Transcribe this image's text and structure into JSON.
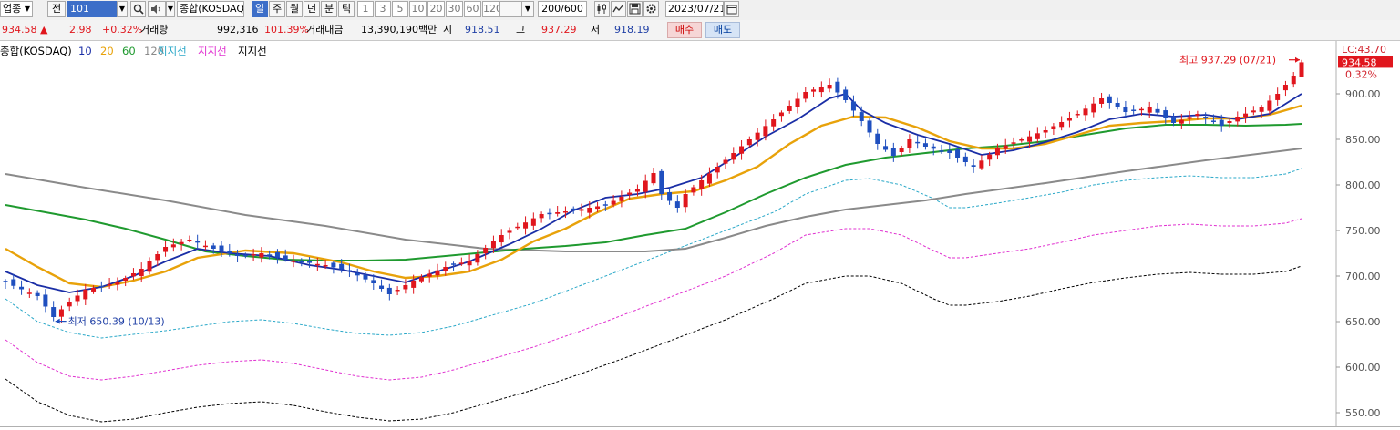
{
  "toolbar": {
    "market_type": "업종",
    "prev_label": "전",
    "code": "101",
    "sound_icon": "speaker-icon",
    "index_name": "종합(KOSDAQ)",
    "periods": [
      "일",
      "주",
      "월",
      "년",
      "분",
      "틱"
    ],
    "selected_period": "일",
    "intervals": [
      "1",
      "3",
      "5",
      "10",
      "20",
      "30",
      "60",
      "120"
    ],
    "count_display": "200/600",
    "date": "2023/07/21"
  },
  "info": {
    "price": "934.58",
    "direction_symbol": "▲",
    "change": "2.98",
    "change_pct": "+0.32%",
    "volume_label": "거래량",
    "volume": "992,316",
    "volume_ratio": "101.39%",
    "amount_label": "거래대금",
    "amount": "13,390,190백만",
    "open_label": "시",
    "open": "918.51",
    "high_label": "고",
    "high": "937.29",
    "low_label": "저",
    "low": "918.19",
    "buy_label": "매수",
    "sell_label": "매도"
  },
  "legend": {
    "index_name": "종합(KOSDAQ)",
    "ma": [
      {
        "label": "10",
        "color": "#1a2ea6"
      },
      {
        "label": "20",
        "color": "#e8a20a"
      },
      {
        "label": "60",
        "color": "#1f9a2f"
      },
      {
        "label": "120",
        "color": "#8a8a8a"
      }
    ],
    "support": [
      {
        "label": "지지선",
        "color": "#2aa8c8"
      },
      {
        "label": "지지선",
        "color": "#e030d0"
      },
      {
        "label": "지지선",
        "color": "#000000"
      }
    ]
  },
  "annotations": {
    "high_text": "최고 937.29 (07/21)",
    "low_text": "최저 650.39 (10/13)",
    "lc_text": "LC:43.70",
    "last_price_tag": "934.58",
    "last_pct_tag": "0.32%"
  },
  "chart_data": {
    "type": "candlestick",
    "y_ticks": [
      "900.00",
      "850.00",
      "800.00",
      "750.00",
      "700.00",
      "650.00",
      "600.00",
      "550.00"
    ],
    "y_tick_values": [
      900,
      850,
      800,
      750,
      700,
      650,
      600,
      550
    ],
    "ylim": [
      534,
      950
    ],
    "colors": {
      "up": "#e0161d",
      "down": "#1f4fbf",
      "ma10": "#1a2ea6",
      "ma20": "#e8a20a",
      "ma60": "#1f9a2f",
      "ma120": "#8a8a8a",
      "support1": "#2aa8c8",
      "support2": "#e030d0",
      "support3": "#000000"
    },
    "price_path": [
      [
        0,
        693
      ],
      [
        4,
        678
      ],
      [
        6,
        655
      ],
      [
        8,
        672
      ],
      [
        10,
        685
      ],
      [
        14,
        693
      ],
      [
        17,
        708
      ],
      [
        20,
        732
      ],
      [
        23,
        740
      ],
      [
        26,
        730
      ],
      [
        29,
        722
      ],
      [
        32,
        725
      ],
      [
        35,
        718
      ],
      [
        40,
        712
      ],
      [
        43,
        705
      ],
      [
        46,
        692
      ],
      [
        48,
        680
      ],
      [
        51,
        695
      ],
      [
        55,
        710
      ],
      [
        58,
        717
      ],
      [
        62,
        745
      ],
      [
        67,
        768
      ],
      [
        71,
        772
      ],
      [
        75,
        778
      ],
      [
        79,
        796
      ],
      [
        81,
        813
      ],
      [
        82,
        790
      ],
      [
        84,
        775
      ],
      [
        85,
        790
      ],
      [
        87,
        805
      ],
      [
        93,
        850
      ],
      [
        96,
        872
      ],
      [
        100,
        902
      ],
      [
        103,
        910
      ],
      [
        105,
        893
      ],
      [
        107,
        870
      ],
      [
        109,
        845
      ],
      [
        111,
        832
      ],
      [
        113,
        850
      ],
      [
        115,
        842
      ],
      [
        118,
        835
      ],
      [
        121,
        820
      ],
      [
        124,
        840
      ],
      [
        127,
        850
      ],
      [
        130,
        860
      ],
      [
        134,
        878
      ],
      [
        137,
        895
      ],
      [
        140,
        880
      ],
      [
        143,
        885
      ],
      [
        146,
        868
      ],
      [
        149,
        878
      ],
      [
        152,
        865
      ],
      [
        154,
        875
      ],
      [
        157,
        885
      ],
      [
        159,
        900
      ],
      [
        161,
        920
      ],
      [
        162,
        934.58
      ]
    ],
    "ma10": [
      [
        0,
        705
      ],
      [
        4,
        690
      ],
      [
        8,
        682
      ],
      [
        12,
        688
      ],
      [
        16,
        700
      ],
      [
        20,
        716
      ],
      [
        24,
        730
      ],
      [
        28,
        725
      ],
      [
        33,
        722
      ],
      [
        38,
        712
      ],
      [
        42,
        707
      ],
      [
        46,
        700
      ],
      [
        50,
        693
      ],
      [
        54,
        705
      ],
      [
        58,
        716
      ],
      [
        63,
        735
      ],
      [
        67,
        752
      ],
      [
        71,
        772
      ],
      [
        75,
        786
      ],
      [
        79,
        790
      ],
      [
        83,
        797
      ],
      [
        87,
        808
      ],
      [
        91,
        830
      ],
      [
        95,
        853
      ],
      [
        99,
        872
      ],
      [
        103,
        895
      ],
      [
        105,
        900
      ],
      [
        107,
        882
      ],
      [
        110,
        868
      ],
      [
        114,
        855
      ],
      [
        118,
        845
      ],
      [
        122,
        833
      ],
      [
        126,
        838
      ],
      [
        130,
        847
      ],
      [
        134,
        858
      ],
      [
        138,
        872
      ],
      [
        142,
        878
      ],
      [
        146,
        875
      ],
      [
        150,
        877
      ],
      [
        154,
        872
      ],
      [
        158,
        878
      ],
      [
        162,
        900
      ]
    ],
    "ma20": [
      [
        0,
        730
      ],
      [
        4,
        710
      ],
      [
        8,
        692
      ],
      [
        12,
        688
      ],
      [
        16,
        695
      ],
      [
        20,
        705
      ],
      [
        24,
        720
      ],
      [
        30,
        728
      ],
      [
        36,
        725
      ],
      [
        42,
        715
      ],
      [
        46,
        705
      ],
      [
        50,
        698
      ],
      [
        54,
        700
      ],
      [
        58,
        705
      ],
      [
        62,
        718
      ],
      [
        66,
        738
      ],
      [
        70,
        752
      ],
      [
        74,
        770
      ],
      [
        78,
        785
      ],
      [
        82,
        790
      ],
      [
        86,
        793
      ],
      [
        90,
        805
      ],
      [
        94,
        820
      ],
      [
        98,
        845
      ],
      [
        102,
        865
      ],
      [
        106,
        875
      ],
      [
        110,
        874
      ],
      [
        114,
        863
      ],
      [
        118,
        848
      ],
      [
        122,
        840
      ],
      [
        126,
        840
      ],
      [
        130,
        845
      ],
      [
        134,
        855
      ],
      [
        138,
        865
      ],
      [
        142,
        868
      ],
      [
        146,
        870
      ],
      [
        150,
        873
      ],
      [
        154,
        873
      ],
      [
        158,
        877
      ],
      [
        162,
        887
      ]
    ],
    "ma60": [
      [
        0,
        778
      ],
      [
        5,
        770
      ],
      [
        10,
        762
      ],
      [
        15,
        752
      ],
      [
        20,
        740
      ],
      [
        25,
        727
      ],
      [
        30,
        722
      ],
      [
        35,
        718
      ],
      [
        40,
        717
      ],
      [
        45,
        717
      ],
      [
        50,
        718
      ],
      [
        55,
        722
      ],
      [
        60,
        726
      ],
      [
        65,
        730
      ],
      [
        70,
        733
      ],
      [
        75,
        737
      ],
      [
        80,
        745
      ],
      [
        85,
        752
      ],
      [
        90,
        770
      ],
      [
        95,
        790
      ],
      [
        100,
        808
      ],
      [
        105,
        822
      ],
      [
        110,
        830
      ],
      [
        115,
        835
      ],
      [
        120,
        840
      ],
      [
        125,
        843
      ],
      [
        130,
        848
      ],
      [
        135,
        855
      ],
      [
        140,
        862
      ],
      [
        145,
        866
      ],
      [
        150,
        866
      ],
      [
        155,
        865
      ],
      [
        160,
        866
      ],
      [
        162,
        867
      ]
    ],
    "ma120": [
      [
        0,
        812
      ],
      [
        10,
        797
      ],
      [
        20,
        783
      ],
      [
        30,
        767
      ],
      [
        40,
        755
      ],
      [
        50,
        740
      ],
      [
        60,
        730
      ],
      [
        70,
        727
      ],
      [
        80,
        727
      ],
      [
        85,
        730
      ],
      [
        90,
        742
      ],
      [
        95,
        755
      ],
      [
        100,
        765
      ],
      [
        105,
        773
      ],
      [
        110,
        778
      ],
      [
        115,
        783
      ],
      [
        120,
        790
      ],
      [
        130,
        802
      ],
      [
        140,
        815
      ],
      [
        150,
        827
      ],
      [
        162,
        840
      ]
    ],
    "support1": [
      [
        0,
        675
      ],
      [
        4,
        650
      ],
      [
        8,
        638
      ],
      [
        12,
        632
      ],
      [
        16,
        636
      ],
      [
        20,
        640
      ],
      [
        24,
        645
      ],
      [
        28,
        650
      ],
      [
        32,
        652
      ],
      [
        36,
        648
      ],
      [
        40,
        642
      ],
      [
        44,
        637
      ],
      [
        48,
        635
      ],
      [
        52,
        638
      ],
      [
        56,
        645
      ],
      [
        60,
        655
      ],
      [
        66,
        670
      ],
      [
        72,
        690
      ],
      [
        78,
        710
      ],
      [
        84,
        730
      ],
      [
        90,
        750
      ],
      [
        96,
        770
      ],
      [
        100,
        790
      ],
      [
        105,
        805
      ],
      [
        108,
        807
      ],
      [
        112,
        800
      ],
      [
        116,
        785
      ],
      [
        118,
        775
      ],
      [
        120,
        775
      ],
      [
        124,
        780
      ],
      [
        128,
        786
      ],
      [
        132,
        792
      ],
      [
        136,
        800
      ],
      [
        140,
        805
      ],
      [
        144,
        808
      ],
      [
        148,
        810
      ],
      [
        152,
        808
      ],
      [
        156,
        808
      ],
      [
        160,
        812
      ],
      [
        162,
        818
      ]
    ],
    "support2": [
      [
        0,
        630
      ],
      [
        4,
        605
      ],
      [
        8,
        590
      ],
      [
        12,
        586
      ],
      [
        16,
        590
      ],
      [
        20,
        596
      ],
      [
        24,
        602
      ],
      [
        28,
        606
      ],
      [
        32,
        608
      ],
      [
        36,
        604
      ],
      [
        40,
        597
      ],
      [
        44,
        590
      ],
      [
        48,
        586
      ],
      [
        52,
        589
      ],
      [
        56,
        597
      ],
      [
        60,
        607
      ],
      [
        66,
        622
      ],
      [
        72,
        640
      ],
      [
        78,
        660
      ],
      [
        84,
        680
      ],
      [
        90,
        700
      ],
      [
        96,
        725
      ],
      [
        100,
        745
      ],
      [
        105,
        752
      ],
      [
        108,
        752
      ],
      [
        112,
        745
      ],
      [
        116,
        728
      ],
      [
        118,
        720
      ],
      [
        120,
        720
      ],
      [
        124,
        725
      ],
      [
        128,
        730
      ],
      [
        132,
        737
      ],
      [
        136,
        745
      ],
      [
        140,
        750
      ],
      [
        144,
        755
      ],
      [
        148,
        757
      ],
      [
        152,
        755
      ],
      [
        156,
        755
      ],
      [
        160,
        758
      ],
      [
        162,
        763
      ]
    ],
    "support3": [
      [
        0,
        587
      ],
      [
        4,
        562
      ],
      [
        8,
        547
      ],
      [
        12,
        540
      ],
      [
        16,
        543
      ],
      [
        20,
        550
      ],
      [
        24,
        556
      ],
      [
        28,
        560
      ],
      [
        32,
        562
      ],
      [
        36,
        558
      ],
      [
        40,
        551
      ],
      [
        44,
        545
      ],
      [
        48,
        541
      ],
      [
        52,
        543
      ],
      [
        56,
        550
      ],
      [
        60,
        560
      ],
      [
        66,
        575
      ],
      [
        72,
        593
      ],
      [
        78,
        612
      ],
      [
        84,
        632
      ],
      [
        90,
        652
      ],
      [
        96,
        675
      ],
      [
        100,
        692
      ],
      [
        105,
        700
      ],
      [
        108,
        700
      ],
      [
        112,
        692
      ],
      [
        116,
        675
      ],
      [
        118,
        668
      ],
      [
        120,
        668
      ],
      [
        124,
        672
      ],
      [
        128,
        678
      ],
      [
        132,
        686
      ],
      [
        136,
        693
      ],
      [
        140,
        698
      ],
      [
        144,
        702
      ],
      [
        148,
        704
      ],
      [
        152,
        702
      ],
      [
        156,
        702
      ],
      [
        160,
        705
      ],
      [
        162,
        711
      ]
    ]
  }
}
